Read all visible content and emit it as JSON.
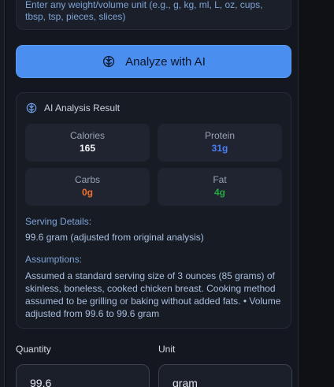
{
  "hint": {
    "text": "Enter any weight/volume unit (e.g., g, kg, ml, L, oz, cups, tbsp, tsp, pieces, slices)"
  },
  "analyze_button": {
    "label": "Analyze with AI",
    "icon": "brain-icon",
    "color": "#4a8ff0"
  },
  "result": {
    "title": "AI Analysis Result",
    "icon": "brain-icon",
    "stats": [
      {
        "label": "Calories",
        "value": "165",
        "color": "#f1f3f7"
      },
      {
        "label": "Protein",
        "value": "31g",
        "color": "#4a7ff5"
      },
      {
        "label": "Carbs",
        "value": "0g",
        "color": "#f0702a"
      },
      {
        "label": "Fat",
        "value": "4g",
        "color": "#27a843"
      }
    ],
    "serving_label": "Serving Details:",
    "serving_text": "99.6 gram (adjusted from original analysis)",
    "assumptions_label": "Assumptions:",
    "assumptions_text": "Assumed a standard serving size of 3 ounces (85 grams) of skinless, boneless, cooked chicken breast. Cooking method assumed to be grilling or baking without added fats. • Volume adjusted from 99.6 to 99.6 gram"
  },
  "form": {
    "quantity_label": "Quantity",
    "quantity_value": "99.6",
    "unit_label": "Unit",
    "unit_value": "gram"
  }
}
